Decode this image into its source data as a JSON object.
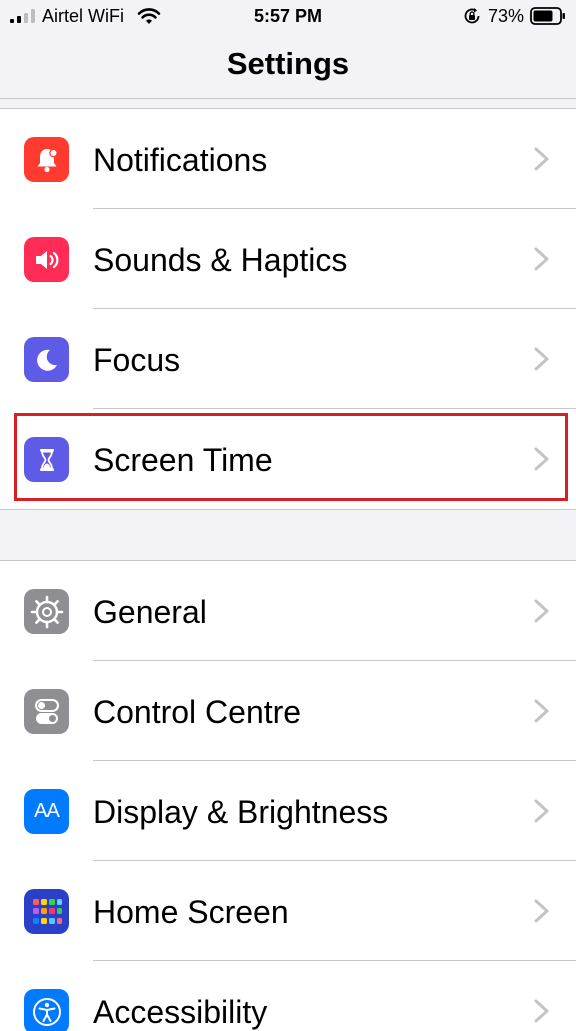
{
  "status_bar": {
    "carrier": "Airtel WiFi",
    "time": "5:57 PM",
    "battery_percent": "73%",
    "icons": [
      "signal-icon",
      "wifi-icon",
      "orientation-lock-icon",
      "battery-icon"
    ]
  },
  "nav": {
    "title": "Settings"
  },
  "groups": [
    {
      "items": [
        {
          "label": "Notifications",
          "icon": "bell-icon",
          "color": "#ff3b30"
        },
        {
          "label": "Sounds & Haptics",
          "icon": "speaker-icon",
          "color": "#ff2d55"
        },
        {
          "label": "Focus",
          "icon": "moon-icon",
          "color": "#5e5ce6"
        },
        {
          "label": "Screen Time",
          "icon": "hourglass-icon",
          "color": "#5e5ce6",
          "highlighted": true
        }
      ]
    },
    {
      "items": [
        {
          "label": "General",
          "icon": "gear-icon",
          "color": "#8e8e93"
        },
        {
          "label": "Control Centre",
          "icon": "toggles-icon",
          "color": "#8e8e93"
        },
        {
          "label": "Display & Brightness",
          "icon": "text-size-icon",
          "color": "#007aff",
          "glyph": "AA"
        },
        {
          "label": "Home Screen",
          "icon": "app-grid-icon",
          "color": "#2c3fc7"
        },
        {
          "label": "Accessibility",
          "icon": "accessibility-icon",
          "color": "#007aff"
        }
      ]
    }
  ],
  "colors": {
    "background": "#f2f2f7",
    "separator": "#c8c7cc",
    "chevron": "#c4c4c7",
    "highlight_border": "#d61f26"
  }
}
